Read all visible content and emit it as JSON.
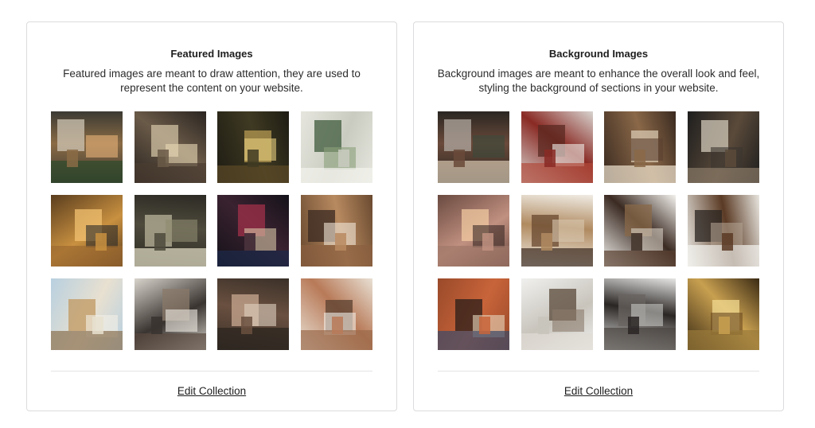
{
  "collections": [
    {
      "id": "featured",
      "title": "Featured Images",
      "description": "Featured images are meant to draw attention, they are used to represent the content on your website.",
      "edit_label": "Edit Collection",
      "images": [
        {
          "name": "cafe-plants-image",
          "colors": [
            "#3b3a33",
            "#8a6b45",
            "#cfc6b4",
            "#e8b27a",
            "#2e4a2a"
          ]
        },
        {
          "name": "cafe-counter-image",
          "colors": [
            "#2a2420",
            "#6a5a48",
            "#cfc0a2",
            "#e9d8b6",
            "#4a3c30"
          ]
        },
        {
          "name": "cafe-night-bar-image",
          "colors": [
            "#1e1c14",
            "#3f3a22",
            "#b59a52",
            "#e8cf7e",
            "#5c4a26"
          ]
        },
        {
          "name": "cafe-green-booth-image",
          "colors": [
            "#e6e6de",
            "#c9cbc0",
            "#3f5b3c",
            "#8aa07a",
            "#f4f3ee"
          ]
        },
        {
          "name": "cafe-people-window-image",
          "colors": [
            "#5a3d1e",
            "#c89040",
            "#f0c070",
            "#2a2a2a",
            "#9c6a30"
          ]
        },
        {
          "name": "cafe-dark-shop-image",
          "colors": [
            "#2c2a24",
            "#4e4a3c",
            "#b8b39a",
            "#8d8a70",
            "#e6e1c8"
          ]
        },
        {
          "name": "cafe-chalk-sign-image",
          "colors": [
            "#14121a",
            "#3a2230",
            "#a0304a",
            "#d8c8a8",
            "#1c2a4a"
          ]
        },
        {
          "name": "cafe-interior-lamps-image",
          "colors": [
            "#6a4a30",
            "#b88a60",
            "#3a2a22",
            "#f0e6d8",
            "#8a6040"
          ]
        },
        {
          "name": "cafe-white-chairs-image",
          "colors": [
            "#b8d0e0",
            "#e8e0d0",
            "#c09860",
            "#f4f0e8",
            "#8a7050"
          ]
        },
        {
          "name": "cafe-friends-table-image",
          "colors": [
            "#d8d4cc",
            "#3a3430",
            "#8a7a6a",
            "#f0ece4",
            "#5a4a40"
          ]
        },
        {
          "name": "cafe-barista-smile-image",
          "colors": [
            "#3a3028",
            "#6a5040",
            "#c8a890",
            "#e0d0c0",
            "#2a241e"
          ]
        },
        {
          "name": "cafe-sunny-window-image",
          "colors": [
            "#e8e0d4",
            "#b87a58",
            "#5a4030",
            "#f4f0ea",
            "#9a6a4a"
          ]
        }
      ]
    },
    {
      "id": "background",
      "title": "Background Images",
      "description": "Background images are meant to enhance the overall look and feel, styling the background of sections in your website.",
      "edit_label": "Edit Collection",
      "images": [
        {
          "name": "cafe-man-coat-image",
          "colors": [
            "#2a2622",
            "#6a4a3a",
            "#b0a8a0",
            "#3a4a3a",
            "#d8c8b0"
          ]
        },
        {
          "name": "cafe-red-chairs-image",
          "colors": [
            "#d8d4d0",
            "#8a2a24",
            "#5a2a22",
            "#f0eeea",
            "#b04a3a"
          ]
        },
        {
          "name": "cafe-tables-rows-image",
          "colors": [
            "#3a2a20",
            "#8a6848",
            "#d8c8b0",
            "#5a4030",
            "#f0e4d0"
          ]
        },
        {
          "name": "cafe-dark-corner-image",
          "colors": [
            "#1e1e1e",
            "#5a4a3a",
            "#d0c8b8",
            "#3a3630",
            "#8a7a68"
          ]
        },
        {
          "name": "cafe-warm-lights-image",
          "colors": [
            "#6a4a40",
            "#c09080",
            "#f0c8a0",
            "#3a2a26",
            "#a0786a"
          ]
        },
        {
          "name": "cafe-long-counter-image",
          "colors": [
            "#f0ece4",
            "#b08a60",
            "#6a4a30",
            "#d8c8b0",
            "#3a2a20"
          ]
        },
        {
          "name": "cafe-white-room-image",
          "colors": [
            "#f4f2ee",
            "#3a2a22",
            "#8a6a4a",
            "#d8d0c4",
            "#5a4030"
          ]
        },
        {
          "name": "cafe-window-tables-image",
          "colors": [
            "#e8e6e0",
            "#5a3a24",
            "#2a2420",
            "#b0a090",
            "#f4f4f0"
          ]
        },
        {
          "name": "cafe-brick-sign-image",
          "colors": [
            "#9a4a2a",
            "#c8643a",
            "#2a1e1a",
            "#e8d8c0",
            "#3a4a6a"
          ]
        },
        {
          "name": "cafe-white-shelves-image",
          "colors": [
            "#f0f0ee",
            "#c8c4bc",
            "#5a4a3a",
            "#8a7a6a",
            "#e0dcd4"
          ]
        },
        {
          "name": "cafe-stools-window-image",
          "colors": [
            "#e6e6e4",
            "#2a2624",
            "#6a6460",
            "#c8c8c4",
            "#4a4440"
          ]
        },
        {
          "name": "cafe-golden-bar-image",
          "colors": [
            "#3a2a14",
            "#c8a050",
            "#f0d890",
            "#6a4a20",
            "#9a7a3a"
          ]
        }
      ]
    }
  ]
}
